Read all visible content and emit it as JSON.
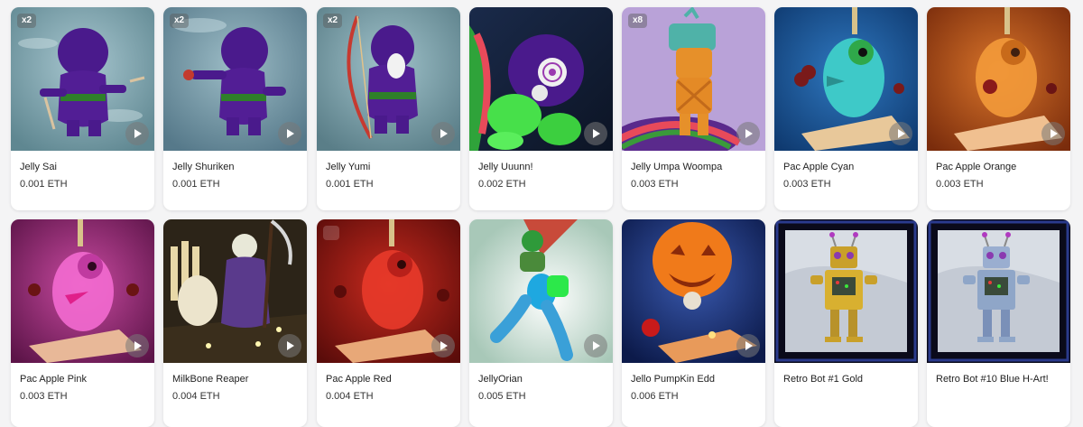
{
  "items": [
    {
      "name": "Jelly Sai",
      "price": "0.001 ETH",
      "badge": "x2",
      "play_icon": "play-icon"
    },
    {
      "name": "Jelly Shuriken",
      "price": "0.001 ETH",
      "badge": "x2",
      "play_icon": "play-icon"
    },
    {
      "name": "Jelly Yumi",
      "price": "0.001 ETH",
      "badge": "x2",
      "play_icon": "play-icon"
    },
    {
      "name": "Jelly Uuunn!",
      "price": "0.002 ETH",
      "badge": "",
      "play_icon": "play-icon"
    },
    {
      "name": "Jelly Umpa Woompa",
      "price": "0.003 ETH",
      "badge": "x8",
      "play_icon": "play-icon"
    },
    {
      "name": "Pac Apple Cyan",
      "price": "0.003 ETH",
      "badge": "",
      "play_icon": "play-icon"
    },
    {
      "name": "Pac Apple Orange",
      "price": "0.003 ETH",
      "badge": "",
      "play_icon": "play-icon"
    },
    {
      "name": "Pac Apple Pink",
      "price": "0.003 ETH",
      "badge": "",
      "play_icon": "play-icon"
    },
    {
      "name": "MilkBone Reaper",
      "price": "0.004 ETH",
      "badge": "",
      "play_icon": "play-icon"
    },
    {
      "name": "Pac Apple Red",
      "price": "0.004 ETH",
      "badge": "",
      "play_icon": "play-icon"
    },
    {
      "name": "JellyOrian",
      "price": "0.005 ETH",
      "badge": "",
      "play_icon": "play-icon"
    },
    {
      "name": "Jello PumpKin Edd",
      "price": "0.006 ETH",
      "badge": "",
      "play_icon": "play-icon"
    },
    {
      "name": "Retro Bot #1 Gold",
      "price": "",
      "badge": "",
      "play_icon": ""
    },
    {
      "name": "Retro Bot #10 Blue H-Art!",
      "price": "",
      "badge": "",
      "play_icon": ""
    }
  ],
  "colors": {
    "page_bg": "#f4f4f5",
    "card_bg": "#ffffff",
    "jelly_purple": "#4a1a8c",
    "ninja_bg": "#7fa3ad",
    "cyan_bg": "#1d5a9c",
    "orange_bg": "#b4561c",
    "pink_bg": "#a0307a",
    "red_bg": "#a01c1c",
    "gold_bot": "#c9a02a",
    "blue_bot": "#8fa6c8"
  }
}
